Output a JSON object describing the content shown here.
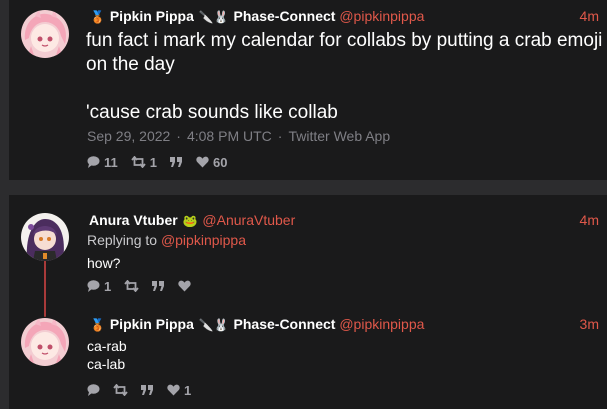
{
  "tweets": [
    {
      "name": "Pipkin Pippa",
      "badges": "🥉 🔪🐰",
      "org": "Phase-Connect",
      "handle": "@pipkinpippa",
      "time": "4m",
      "body_line1": "fun fact i mark my calendar for collabs by putting a crab emoji on the day",
      "body_line2": "'cause crab sounds like collab",
      "meta_date": "Sep 29, 2022",
      "meta_time": "4:08 PM UTC",
      "meta_source": "Twitter Web App",
      "reply_count": "11",
      "retweet_count": "1",
      "like_count": "60",
      "avatar_icon": "avatar-pink-hair"
    },
    {
      "name": "Anura Vtuber",
      "badges": "🐸",
      "handle": "@AnuraVtuber",
      "time": "4m",
      "replying_prefix": "Replying to",
      "replying_handle": "@pipkinpippa",
      "body": "how?",
      "reply_count": "1",
      "retweet_count": "",
      "like_count": "",
      "avatar_icon": "avatar-purple-hair"
    },
    {
      "name": "Pipkin Pippa",
      "badges": "🥉 🔪🐰",
      "org": "Phase-Connect",
      "handle": "@pipkinpippa",
      "time": "3m",
      "body_line1": "ca-rab",
      "body_line2": "ca-lab",
      "reply_count": "",
      "retweet_count": "",
      "like_count": "1",
      "avatar_icon": "avatar-pink-hair"
    }
  ],
  "colors": {
    "accent": "#e0584a",
    "thread_line": "#a83a3a",
    "card_bg": "#1a1a1b",
    "page_bg": "#2c2c2e"
  }
}
